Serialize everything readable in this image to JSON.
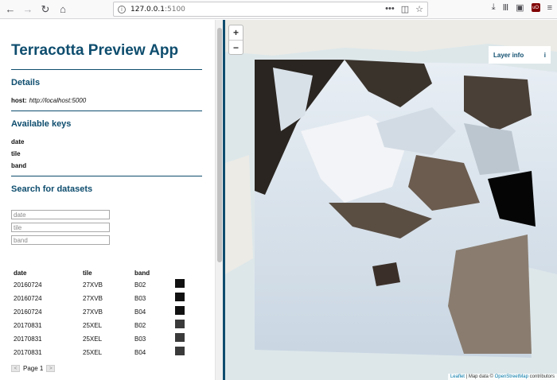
{
  "browser": {
    "url_host": "127.0.0.1",
    "url_port": ":5100",
    "menu_dots": "•••"
  },
  "sidebar": {
    "app_title": "Terracotta Preview App",
    "details_title": "Details",
    "host_label": "host:",
    "host_value": "http://localhost:5000",
    "keys_title": "Available keys",
    "keys": [
      "date",
      "tile",
      "band"
    ],
    "search_title": "Search for datasets",
    "search_placeholders": [
      "date",
      "tile",
      "band"
    ]
  },
  "results": {
    "columns": [
      "date",
      "tile",
      "band"
    ],
    "rows": [
      {
        "date": "20160724",
        "tile": "27XVB",
        "band": "B02"
      },
      {
        "date": "20160724",
        "tile": "27XVB",
        "band": "B03"
      },
      {
        "date": "20160724",
        "tile": "27XVB",
        "band": "B04"
      },
      {
        "date": "20170831",
        "tile": "25XEL",
        "band": "B02"
      },
      {
        "date": "20170831",
        "tile": "25XEL",
        "band": "B03"
      },
      {
        "date": "20170831",
        "tile": "25XEL",
        "band": "B04"
      }
    ],
    "page_label": "Page 1"
  },
  "map": {
    "zoom_in": "+",
    "zoom_out": "−",
    "layer_info_label": "Layer info",
    "layer_info_icon": "i",
    "attribution_leaflet": "Leaflet",
    "attribution_sep": " | Map data © ",
    "attribution_osm": "OpenStreetMap",
    "attribution_suffix": " contributors"
  },
  "icons": [
    "back-icon",
    "forward-icon",
    "reload-icon",
    "home-icon",
    "info-icon",
    "pocket-icon",
    "bookmark-star-icon",
    "download-icon",
    "library-icon",
    "sidebar-icon",
    "ublock-icon",
    "hamburger-menu-icon"
  ],
  "colors": {
    "accent": "#0e4d6e",
    "link": "#0078a8"
  }
}
